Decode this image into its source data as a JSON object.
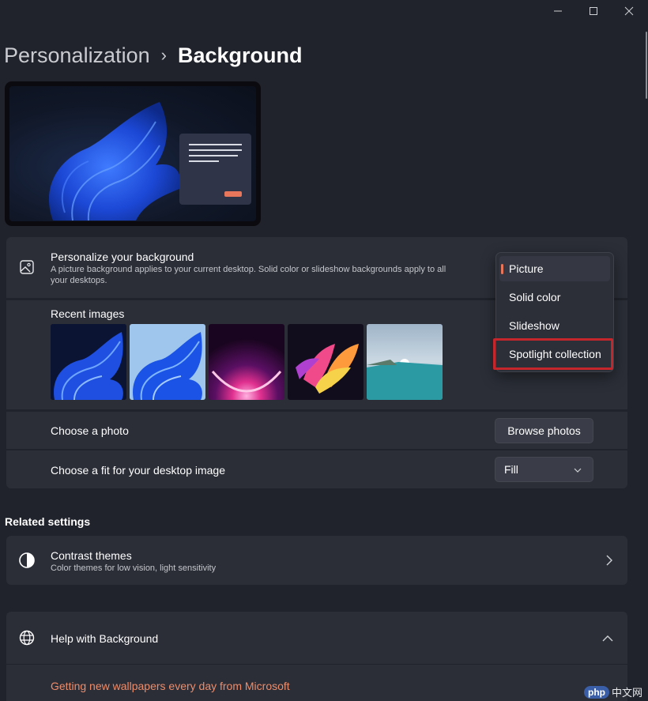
{
  "window": {
    "minimize": "minimize",
    "maximize": "maximize",
    "close": "close"
  },
  "breadcrumb": {
    "parent": "Personalization",
    "separator": "›",
    "current": "Background"
  },
  "background_section": {
    "title": "Personalize your background",
    "description_line1": "A picture background applies to your current desktop. Solid color or slideshow backgrounds apply to all",
    "description_line2": "your desktops.",
    "dropdown": {
      "options": [
        "Picture",
        "Solid color",
        "Slideshow",
        "Spotlight collection"
      ],
      "selected": "Picture",
      "highlighted": "Spotlight collection"
    }
  },
  "recent_images": {
    "label": "Recent images",
    "items": [
      "bloom-dark-blue",
      "bloom-light-blue",
      "purple-glow",
      "pink-flower",
      "seaside-sunrise"
    ]
  },
  "choose_photo": {
    "label": "Choose a photo",
    "button": "Browse photos"
  },
  "choose_fit": {
    "label": "Choose a fit for your desktop image",
    "value": "Fill"
  },
  "related_settings": {
    "heading": "Related settings",
    "contrast": {
      "title": "Contrast themes",
      "subtitle": "Color themes for low vision, light sensitivity"
    }
  },
  "help": {
    "title": "Help with Background",
    "link": "Getting new wallpapers every day from Microsoft"
  },
  "watermark": {
    "brand": "php",
    "site": "中文网"
  },
  "colors": {
    "accent": "#e8765a",
    "highlight_border": "#c4262b",
    "background": "#20232b",
    "card": "#2b2e37"
  }
}
